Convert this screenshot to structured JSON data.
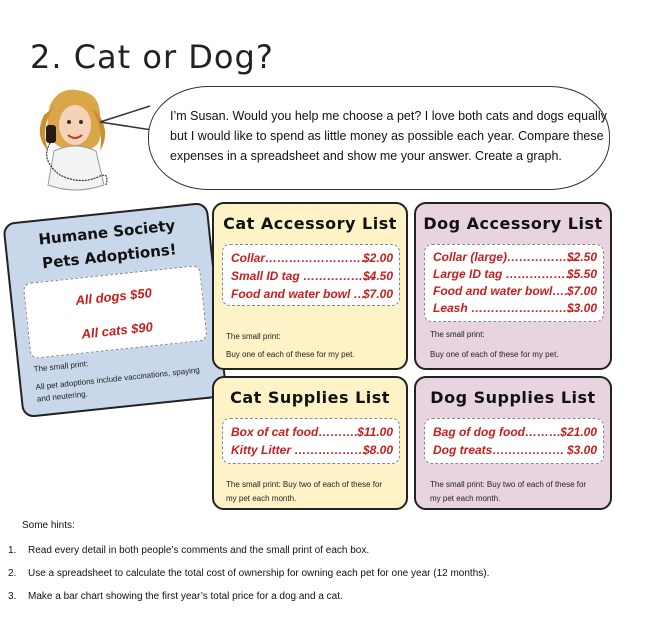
{
  "title": "2. Cat or Dog?",
  "speech": {
    "lines": [
      "I’m Susan. Would you help me choose a pet? I love both cats and dogs equally",
      "but I would like to spend as little money as possible each year.  Compare these",
      "expenses in a spreadsheet and show me your answer. Create a graph."
    ]
  },
  "humane": {
    "title_line1": "Humane Society",
    "title_line2": "Pets Adoptions!",
    "items": [
      "All dogs $50",
      "All cats $90"
    ],
    "small_label": "The small print:",
    "small_text_line1": "All pet adoptions include vaccinations, spaying",
    "small_text_line2": "and neutering."
  },
  "cat_accessory": {
    "title": "Cat Accessory List",
    "items": [
      {
        "name": "Collar………………………",
        "price": "$2.00"
      },
      {
        "name": "Small ID tag ………………",
        "price": "$4.50"
      },
      {
        "name": "Food and water bowl …",
        "price": "$7.00"
      }
    ],
    "small_label": "The small print:",
    "small_text": "Buy one of each of these for my pet."
  },
  "dog_accessory": {
    "title": "Dog Accessory List",
    "items": [
      {
        "name": "Collar (large)………………",
        "price": "$2.50"
      },
      {
        "name": "Large ID tag ………………",
        "price": "$5.50"
      },
      {
        "name": "Food and water bowl….",
        "price": "$7.00"
      },
      {
        "name": "Leash ………………………",
        "price": "$3.00"
      }
    ],
    "small_label": "The small print:",
    "small_text": "Buy one of each of these for my pet."
  },
  "cat_supplies": {
    "title": "Cat Supplies List",
    "items": [
      {
        "name": "Box of cat food……….",
        "price": "$11.00"
      },
      {
        "name": "Kitty Litter ………………",
        "price": "$8.00"
      }
    ],
    "small_line1": "The small print: Buy two of each of these for",
    "small_line2": "my pet each month."
  },
  "dog_supplies": {
    "title": "Dog Supplies List",
    "items": [
      {
        "name": "Bag of dog food………",
        "price": "$21.00"
      },
      {
        "name": "Dog treats………………",
        "price": "$3.00"
      }
    ],
    "small_line1": "The small print: Buy two of each of these for",
    "small_line2": "my pet each month."
  },
  "hints": {
    "label": "Some hints:",
    "items": [
      {
        "num": "1.",
        "text": "Read every detail in both people’s comments and the small print of each box."
      },
      {
        "num": "2.",
        "text": "Use a spreadsheet to calculate the total cost of ownership for owning each pet for one year (12 months)."
      },
      {
        "num": "3.",
        "text": "Make a bar chart showing the first year’s total price for a dog and a cat."
      }
    ]
  },
  "colors": {
    "cat_card": "#fdf3c6",
    "dog_card": "#e8d4e0",
    "humane_card": "#c9d7ea",
    "price_red": "#c81e1e"
  }
}
